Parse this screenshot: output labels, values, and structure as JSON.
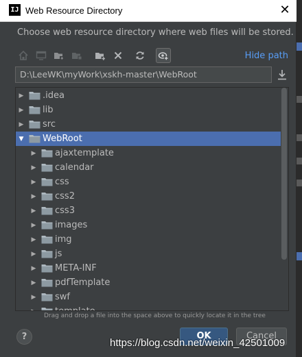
{
  "window": {
    "title": "Web Resource Directory",
    "app_icon_text": "IJ",
    "close_symbol": "✕"
  },
  "description": "Choose web resource directory where web files will be stored.",
  "toolbar": {
    "icons": [
      "home-icon",
      "desktop-icon",
      "new-folder-icon",
      "project-folder-icon",
      "add-folder-icon",
      "delete-icon",
      "refresh-icon",
      "show-hidden-icon"
    ],
    "hide_path_label": "Hide path"
  },
  "path": {
    "value": "D:\\LeeWK\\myWork\\xskh-master\\WebRoot"
  },
  "tree": {
    "rows": [
      {
        "label": ".idea",
        "expanded": false,
        "level": 0,
        "selected": false
      },
      {
        "label": "lib",
        "expanded": false,
        "level": 0,
        "selected": false
      },
      {
        "label": "src",
        "expanded": false,
        "level": 0,
        "selected": false
      },
      {
        "label": "WebRoot",
        "expanded": true,
        "level": 0,
        "selected": true
      },
      {
        "label": "ajaxtemplate",
        "expanded": false,
        "level": 1,
        "selected": false
      },
      {
        "label": "calendar",
        "expanded": false,
        "level": 1,
        "selected": false
      },
      {
        "label": "css",
        "expanded": false,
        "level": 1,
        "selected": false
      },
      {
        "label": "css2",
        "expanded": false,
        "level": 1,
        "selected": false
      },
      {
        "label": "css3",
        "expanded": false,
        "level": 1,
        "selected": false
      },
      {
        "label": "images",
        "expanded": false,
        "level": 1,
        "selected": false
      },
      {
        "label": "img",
        "expanded": false,
        "level": 1,
        "selected": false
      },
      {
        "label": "js",
        "expanded": false,
        "level": 1,
        "selected": false
      },
      {
        "label": "META-INF",
        "expanded": false,
        "level": 1,
        "selected": false
      },
      {
        "label": "pdfTemplate",
        "expanded": false,
        "level": 1,
        "selected": false
      },
      {
        "label": "swf",
        "expanded": false,
        "level": 1,
        "selected": false
      },
      {
        "label": "template",
        "expanded": false,
        "level": 1,
        "selected": false
      }
    ]
  },
  "hint": "Drag and drop a file into the space above to quickly locate it in the tree",
  "buttons": {
    "help": "?",
    "ok": "OK",
    "cancel": "Cancel"
  },
  "watermark": "https://blog.csdn.net/weixin_42501009",
  "colors": {
    "selection": "#4b6eaf",
    "link": "#589df6",
    "background": "#3c3f41",
    "ok_button": "#365880"
  }
}
